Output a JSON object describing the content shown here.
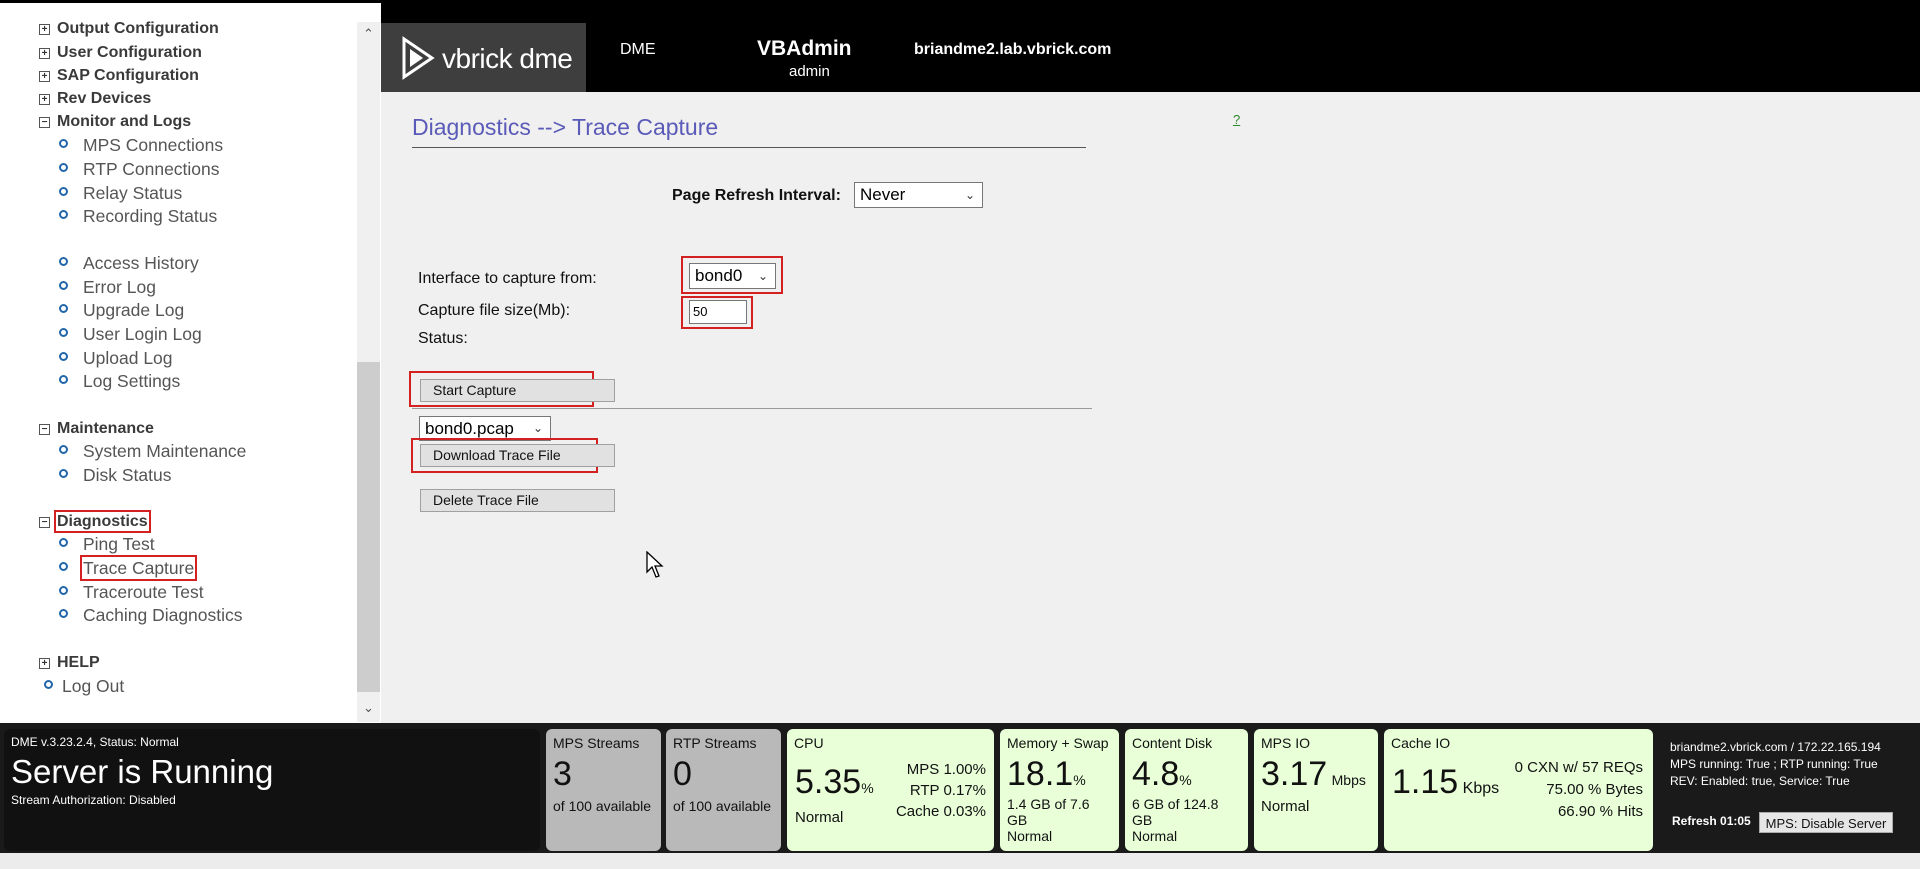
{
  "sidebar": {
    "groups": {
      "output_config": "Output Configuration",
      "user_config": "User Configuration",
      "sap_config": "SAP Configuration",
      "rev_devices": "Rev Devices",
      "monitor_logs": "Monitor and Logs",
      "maintenance": "Maintenance",
      "diagnostics": "Diagnostics",
      "help": "HELP"
    },
    "monitor_items": [
      "MPS Connections",
      "RTP Connections",
      "Relay Status",
      "Recording Status"
    ],
    "log_items": [
      "Access History",
      "Error Log",
      "Upgrade Log",
      "User Login Log",
      "Upload Log",
      "Log Settings"
    ],
    "maintenance_items": [
      "System Maintenance",
      "Disk Status"
    ],
    "diagnostics_items": [
      "Ping Test",
      "Trace Capture",
      "Traceroute Test",
      "Caching Diagnostics"
    ],
    "logout": "Log Out"
  },
  "header": {
    "logo_text": "vbrick dme",
    "dme": "DME",
    "user": "VBAdmin",
    "role": "admin",
    "host": "briandme2.lab.vbrick.com"
  },
  "main": {
    "title": "Diagnostics --> Trace Capture",
    "help": "?",
    "refresh_label": "Page Refresh Interval:",
    "refresh_value": "Never",
    "interface_label": "Interface to capture from:",
    "interface_value": "bond0",
    "size_label": "Capture file size(Mb):",
    "size_value": "50",
    "status_label": "Status:",
    "start_capture": "Start Capture",
    "trace_file": "bond0.pcap",
    "download": "Download Trace File",
    "delete": "Delete Trace File"
  },
  "status": {
    "version": "DME v.3.23.2.4, Status: Normal",
    "running": "Server is Running",
    "stream_auth": "Stream Authorization: Disabled",
    "mps_streams": {
      "label": "MPS Streams",
      "value": "3",
      "sub": "of 100 available"
    },
    "rtp_streams": {
      "label": "RTP Streams",
      "value": "0",
      "sub": "of 100 available"
    },
    "cpu": {
      "label": "CPU",
      "value": "5.35",
      "unit": "%",
      "state": "Normal",
      "mps": "MPS 1.00%",
      "rtp": "RTP 0.17%",
      "cache": "Cache 0.03%"
    },
    "memory": {
      "label": "Memory + Swap",
      "value": "18.1",
      "unit": "%",
      "detail": "1.4 GB of 7.6 GB",
      "state": "Normal"
    },
    "disk": {
      "label": "Content Disk",
      "value": "4.8",
      "unit": "%",
      "detail": "6 GB of 124.8 GB",
      "state": "Normal"
    },
    "mps_io": {
      "label": "MPS IO",
      "value": "3.17",
      "unit": "Mbps",
      "state": "Normal"
    },
    "cache_io": {
      "label": "Cache IO",
      "value": "1.15",
      "unit": "Kbps",
      "cxn": "0 CXN w/ 57 REQs",
      "bytes": "75.00 % Bytes",
      "hits": "66.90 % Hits"
    },
    "info_host": "briandme2.vbrick.com / 172.22.165.194",
    "info_running": "MPS running: True ;   RTP running: True",
    "info_rev": "REV: Enabled: true, Service: True",
    "refresh": "Refresh 01:05",
    "disable_btn": "MPS: Disable Server"
  }
}
